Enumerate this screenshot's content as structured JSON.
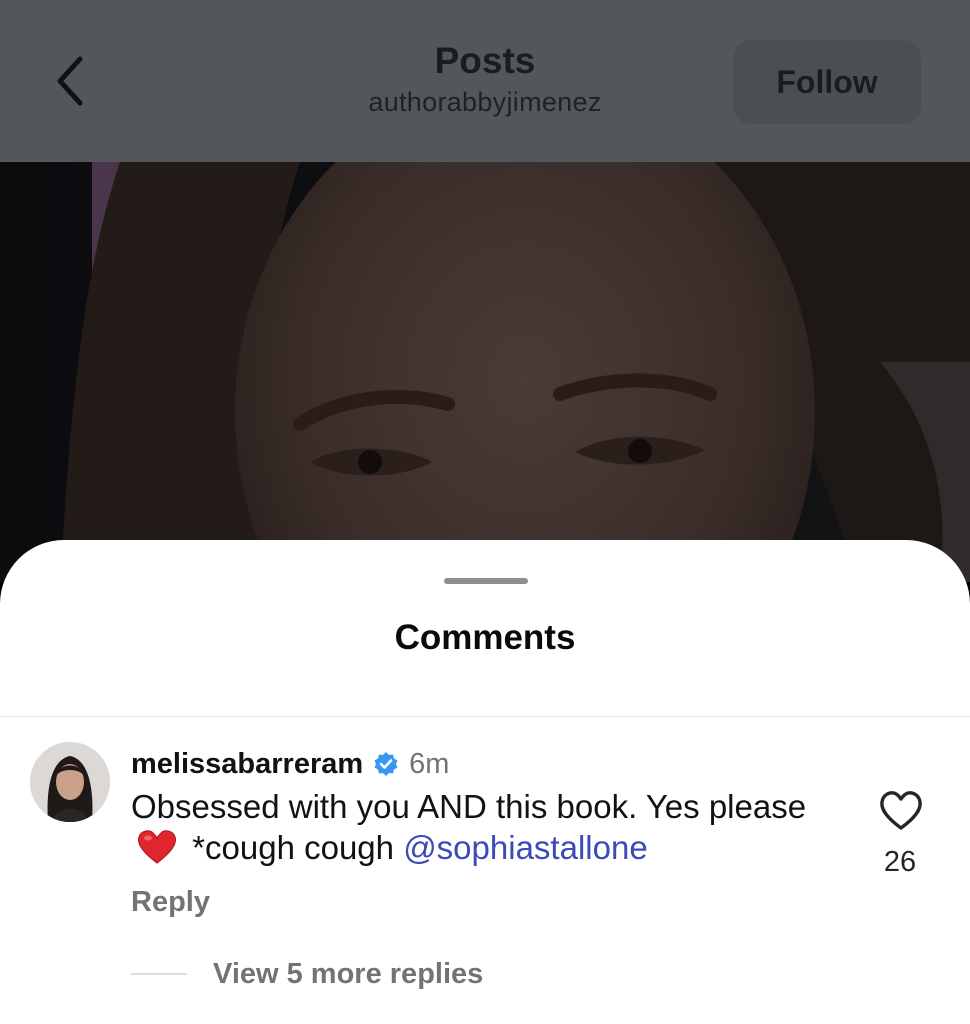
{
  "header": {
    "title": "Posts",
    "subtitle": "authorabbyjimenez",
    "follow_label": "Follow"
  },
  "icons": {
    "back": "chevron-left-icon",
    "verified": "verified-badge-icon",
    "like": "heart-outline-icon",
    "heart_emoji": "red-heart-emoji"
  },
  "sheet": {
    "title": "Comments"
  },
  "comment": {
    "username": "melissabarreram",
    "time": "6m",
    "text_part1": "Obsessed with you AND this book. Yes please",
    "text_part2": "*cough cough",
    "mention": "@sophiastallone",
    "reply_label": "Reply",
    "like_count": "26",
    "view_replies_label": "View 5 more replies"
  },
  "colors": {
    "mention": "#3b4ab8",
    "verified": "#3897f0",
    "heart": "#e0262f"
  }
}
